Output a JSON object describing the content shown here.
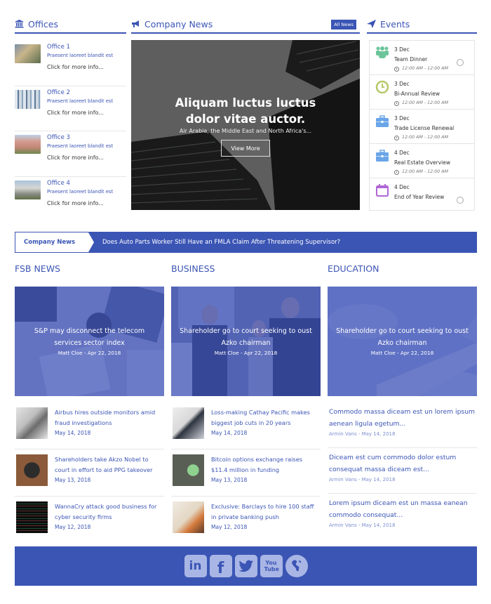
{
  "offices": {
    "title": "Offices",
    "icon": "bank-icon",
    "items": [
      {
        "name": "Office 1",
        "desc": "Praesent laoreet blandit est",
        "more": "Click for more info..."
      },
      {
        "name": "Office 2",
        "desc": "Praesent laoreet blandit est",
        "more": "Click for more info..."
      },
      {
        "name": "Office 3",
        "desc": "Praesent laoreet blandit est",
        "more": "Click for more info..."
      },
      {
        "name": "Office 4",
        "desc": "Praesent laoreet blandit est",
        "more": "Click for more info..."
      }
    ]
  },
  "news": {
    "title": "Company News",
    "icon": "megaphone-icon",
    "all_news_label": "All News",
    "hero": {
      "title_line1": "Aliquam luctus luctus",
      "title_line2": "dolor vitae auctor.",
      "subtitle": "Air Arabia, the Middle East and North Africa's...",
      "button_label": "View More"
    }
  },
  "events": {
    "title": "Events",
    "icon": "paper-plane-icon",
    "items": [
      {
        "date": "3 Dec",
        "name": "Team Dinner",
        "time": "12:00 AM - 12:00 AM",
        "icon": "group-icon",
        "color": "#6cc59a"
      },
      {
        "date": "3 Dec",
        "name": "Bi-Annual Review",
        "time": "12:00 AM - 12:00 AM",
        "icon": "clock-icon",
        "color": "#b5c86a"
      },
      {
        "date": "3 Dec",
        "name": "Trade License Renewal",
        "time": "12:00 AM - 12:00 AM",
        "icon": "briefcase-icon",
        "color": "#6aa5e8"
      },
      {
        "date": "4 Dec",
        "name": "Real Estate Overview",
        "time": "12:00 AM - 12:00 AM",
        "icon": "briefcase-icon",
        "color": "#6aa5e8"
      },
      {
        "date": "4 Dec",
        "name": "End of Year Review",
        "time": "",
        "icon": "calendar-icon",
        "color": "#b066d6"
      }
    ]
  },
  "ticker": {
    "label": "Company News",
    "text": "Does Auto Parts Worker Still Have an FMLA Claim After Threatening Supervisor?"
  },
  "categories": [
    {
      "title": "FSB NEWS",
      "feature": {
        "title": "S&P may disconnect the telecom services sector index",
        "meta": "Matt Cloe - Apr 22, 2018"
      },
      "articles": [
        {
          "title": "Airbus hires outside monitors amid fraud investigations",
          "date": "May 14, 2018"
        },
        {
          "title": "Shareholders take Akzo Nobel to court in effort to aid PPG takeover",
          "date": "May 13, 2018"
        },
        {
          "title": "WannaCry attack good business for cyber security firms",
          "date": "May 12, 2018"
        }
      ]
    },
    {
      "title": "BUSINESS",
      "feature": {
        "title": "Shareholder go to court seeking to oust Azko chairman",
        "meta": "Matt Cloe - Apr 22, 2018"
      },
      "articles": [
        {
          "title": "Loss-making Cathay Pacific makes biggest job cuts in 20 years",
          "date": "May 14, 2018"
        },
        {
          "title": "Bitcoin options exchange raises $11.4 million in funding",
          "date": "May 13, 2018"
        },
        {
          "title": "Exclusive: Barclays to hire 100 staff in private banking push",
          "date": "May 12, 2018"
        }
      ]
    },
    {
      "title": "EDUCATION",
      "feature": {
        "title": "Shareholder go to court seeking to oust Azko chairman",
        "meta": "Matt Cloe - Apr 22, 2018"
      },
      "articles": [
        {
          "title": "Commodo massa diceam est un lorem ipsum aenean ligula egetum...",
          "meta": "Armin Vans - May 14, 2018"
        },
        {
          "title": "Diceam est cum commodo dolor estum consequat massa diceam est...",
          "meta": "Armin Vans - May 14, 2018"
        },
        {
          "title": "Lorem ipsum diceam est un massa eanean commodo consequat...",
          "meta": "Armin Vans - May 14, 2018"
        }
      ]
    }
  ],
  "footer": {
    "social": [
      {
        "name": "linkedin",
        "glyph": "in"
      },
      {
        "name": "facebook",
        "glyph": "f"
      },
      {
        "name": "twitter",
        "glyph": ""
      },
      {
        "name": "youtube",
        "glyph": "You Tube"
      },
      {
        "name": "website",
        "glyph": ""
      }
    ]
  },
  "colors": {
    "brand": "#3b55b5",
    "overlay": "#3c50b9",
    "social_icon": "#a9b6e5"
  }
}
